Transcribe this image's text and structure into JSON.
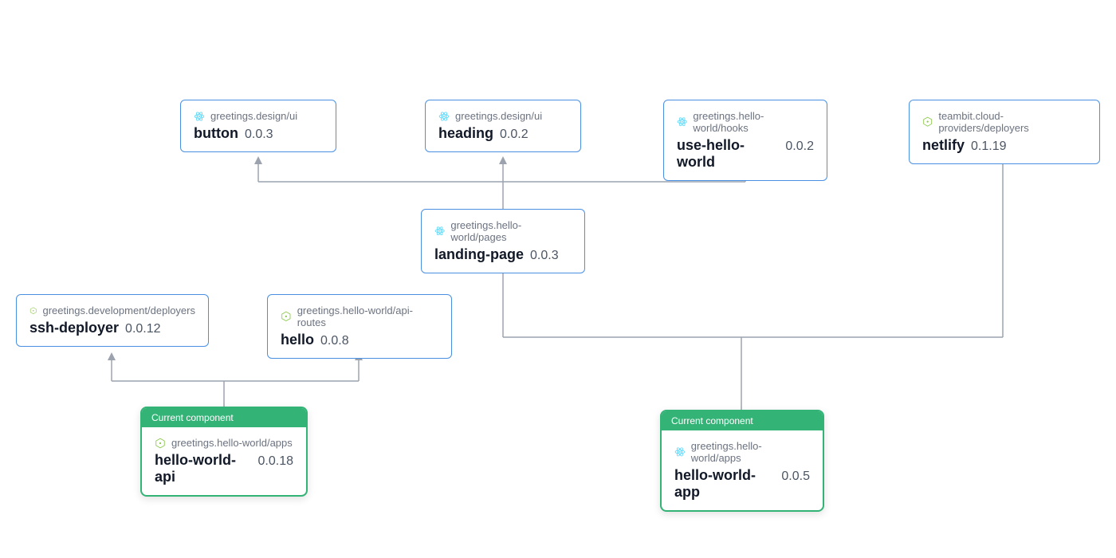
{
  "current_label": "Current component",
  "nodes": {
    "button": {
      "scope": "greetings.design/ui",
      "name": "button",
      "version": "0.0.3",
      "icon": "react"
    },
    "heading": {
      "scope": "greetings.design/ui",
      "name": "heading",
      "version": "0.0.2",
      "icon": "react"
    },
    "useHello": {
      "scope": "greetings.hello-world/hooks",
      "name": "use-hello-world",
      "version": "0.0.2",
      "icon": "react"
    },
    "netlify": {
      "scope": "teambit.cloud-providers/deployers",
      "name": "netlify",
      "version": "0.1.19",
      "icon": "node"
    },
    "landing": {
      "scope": "greetings.hello-world/pages",
      "name": "landing-page",
      "version": "0.0.3",
      "icon": "react"
    },
    "sshDeployer": {
      "scope": "greetings.development/deployers",
      "name": "ssh-deployer",
      "version": "0.0.12",
      "icon": "node"
    },
    "hello": {
      "scope": "greetings.hello-world/api-routes",
      "name": "hello",
      "version": "0.0.8",
      "icon": "node"
    },
    "api": {
      "scope": "greetings.hello-world/apps",
      "name": "hello-world-api",
      "version": "0.0.18",
      "icon": "node"
    },
    "app": {
      "scope": "greetings.hello-world/apps",
      "name": "hello-world-app",
      "version": "0.0.5",
      "icon": "react"
    }
  }
}
